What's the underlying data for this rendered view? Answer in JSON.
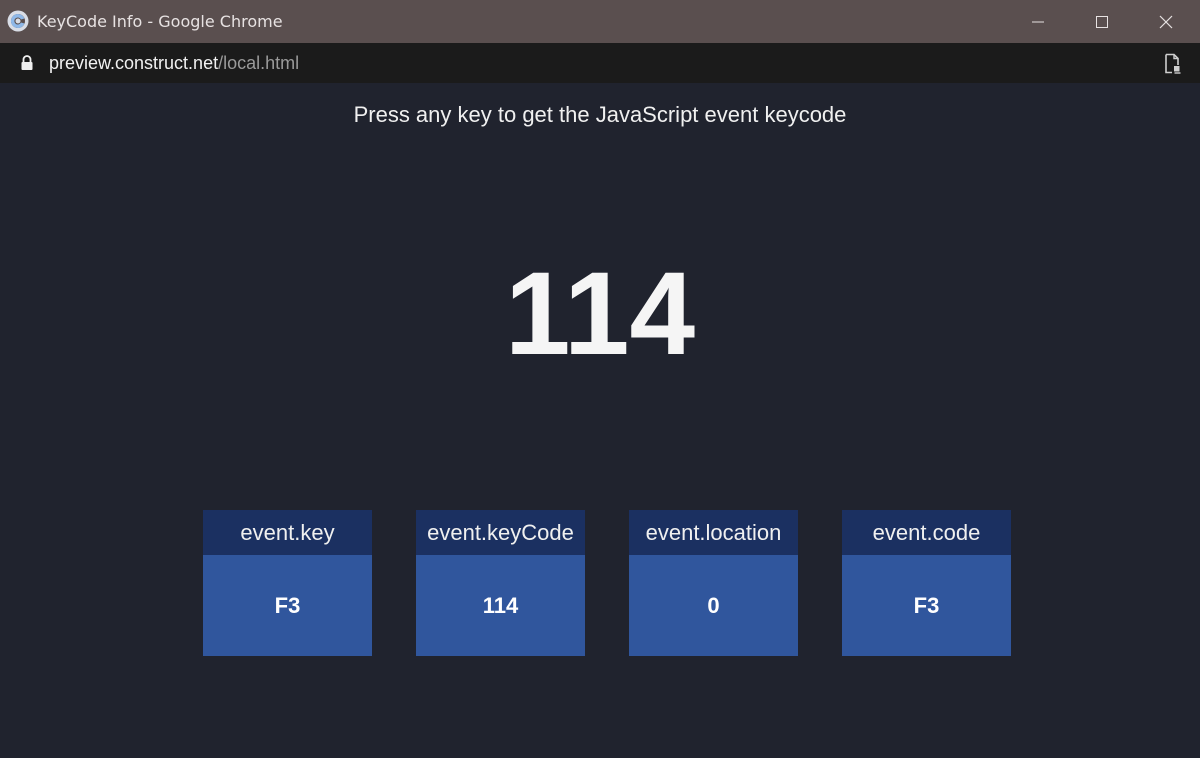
{
  "window": {
    "title": "KeyCode Info - Google Chrome",
    "icon": "construct-logo-icon"
  },
  "controls": {
    "minimize": "minimize-icon",
    "maximize": "maximize-icon",
    "close": "close-icon"
  },
  "address": {
    "host": "preview.construct.net",
    "path": "/local.html",
    "icon": "lock-icon",
    "right_icon": "document-icon"
  },
  "page": {
    "instruction": "Press any key to get the JavaScript event keycode",
    "keycode": "114",
    "cards": [
      {
        "label": "event.key",
        "value": "F3"
      },
      {
        "label": "event.keyCode",
        "value": "114"
      },
      {
        "label": "event.location",
        "value": "0"
      },
      {
        "label": "event.code",
        "value": "F3"
      }
    ]
  },
  "colors": {
    "titlebar": "#5a4f4f",
    "addressbar": "#1b1b1b",
    "background": "#20232e",
    "card_header": "#1b3061",
    "card_body": "#30569d"
  }
}
